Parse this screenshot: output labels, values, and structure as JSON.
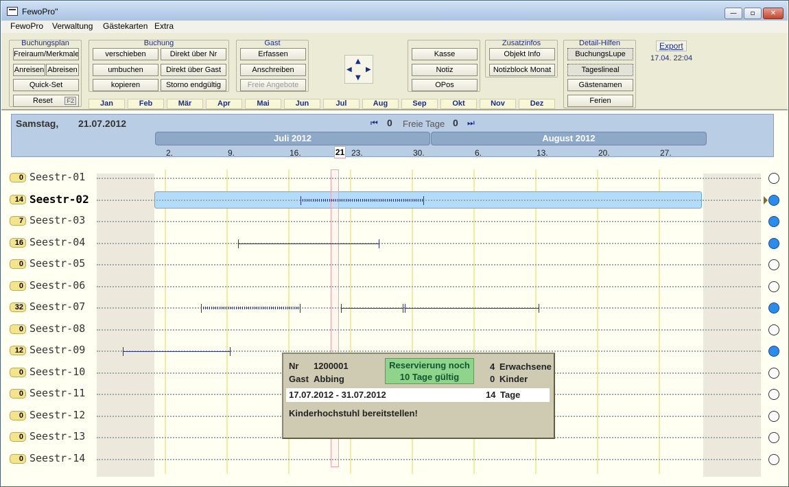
{
  "window": {
    "title": "FewoPro''",
    "minimize": "—",
    "maximize": "▫",
    "close": "✕"
  },
  "menu": [
    "FewoPro",
    "Verwaltung",
    "Gästekarten",
    "Extra"
  ],
  "toolbar": {
    "groups": {
      "buchungsplan": "Buchungsplan",
      "buchung": "Buchung",
      "gast": "Gast",
      "zusatzinfos": "Zusatzinfos",
      "detailhilfen": "Detail-Hilfen"
    },
    "buchungsplan": {
      "freiraum": "Freiraum/Merkmale",
      "anreisen": "Anreisen",
      "abreisen": "Abreisen",
      "quickset": "Quick-Set",
      "reset": "Reset",
      "reset_key": "F2"
    },
    "buchung": {
      "verschieben": "verschieben",
      "umbuchen": "umbuchen",
      "kopieren": "kopieren",
      "direkt_nr": "Direkt über Nr",
      "direkt_gast": "Direkt über Gast",
      "storno": "Storno endgültig"
    },
    "gast": {
      "erfassen": "Erfassen",
      "anschreiben": "Anschreiben",
      "freie_angebote": "Freie Angebote"
    },
    "kasse": {
      "kasse": "Kasse",
      "notiz": "Notiz",
      "opos": "OPos"
    },
    "zusatzinfos": {
      "objekt_info": "Objekt Info",
      "notizblock": "Notizblock Monat"
    },
    "detailhilfen": {
      "buchungslupe": "BuchungsLupe",
      "tageslineal": "Tageslineal",
      "gaestenamen": "Gästenamen",
      "ferien": "Ferien"
    },
    "months": [
      "Jan",
      "Feb",
      "Mär",
      "Apr",
      "Mai",
      "Jun",
      "Jul",
      "Aug",
      "Sep",
      "Okt",
      "Nov",
      "Dez"
    ],
    "export": "Export",
    "export_time": "17.04. 22:04",
    "arrows": {
      "up": "▲",
      "down": "▼",
      "left": "◀",
      "right": "▶"
    }
  },
  "header": {
    "day": "Samstag,",
    "date": "21.07.2012",
    "free_label": "Freie Tage",
    "free_left": "0",
    "free_right": "0",
    "nav_first": "⏮",
    "nav_last": "⏭",
    "month1": "Juli 2012",
    "month2": "August 2012",
    "ticks": [
      "2.",
      "9.",
      "16.",
      "21",
      "23.",
      "30.",
      "6.",
      "13.",
      "20.",
      "27."
    ]
  },
  "rooms": [
    {
      "count": "0",
      "name": "Seestr-01",
      "occupied": false
    },
    {
      "count": "14",
      "name": "Seestr-02",
      "occupied": true,
      "selected": true
    },
    {
      "count": "7",
      "name": "Seestr-03",
      "occupied": true
    },
    {
      "count": "16",
      "name": "Seestr-04",
      "occupied": true
    },
    {
      "count": "0",
      "name": "Seestr-05",
      "occupied": false
    },
    {
      "count": "0",
      "name": "Seestr-06",
      "occupied": false
    },
    {
      "count": "32",
      "name": "Seestr-07",
      "occupied": true
    },
    {
      "count": "0",
      "name": "Seestr-08",
      "occupied": false
    },
    {
      "count": "12",
      "name": "Seestr-09",
      "occupied": true
    },
    {
      "count": "0",
      "name": "Seestr-10",
      "occupied": false
    },
    {
      "count": "0",
      "name": "Seestr-11",
      "occupied": false
    },
    {
      "count": "0",
      "name": "Seestr-12",
      "occupied": false
    },
    {
      "count": "0",
      "name": "Seestr-13",
      "occupied": false
    },
    {
      "count": "0",
      "name": "Seestr-14",
      "occupied": false
    }
  ],
  "popup": {
    "nr_label": "Nr",
    "nr": "1200001",
    "gast_label": "Gast",
    "gast": "Abbing",
    "reservation_line1": "Reservierung noch",
    "reservation_line2": "10 Tage  gültig",
    "adults_count": "4",
    "adults_label": "Erwachsene",
    "children_count": "0",
    "children_label": "Kinder",
    "range": "17.07.2012 - 31.07.2012",
    "days_count": "14",
    "days_label": "Tage",
    "note": "Kinderhochstuhl bereitstellen!"
  },
  "colors": {
    "accent": "#1a2c8a",
    "selection": "#b3dcfa",
    "occupied": "#2b8cef",
    "reservation": "#8fd48a"
  }
}
